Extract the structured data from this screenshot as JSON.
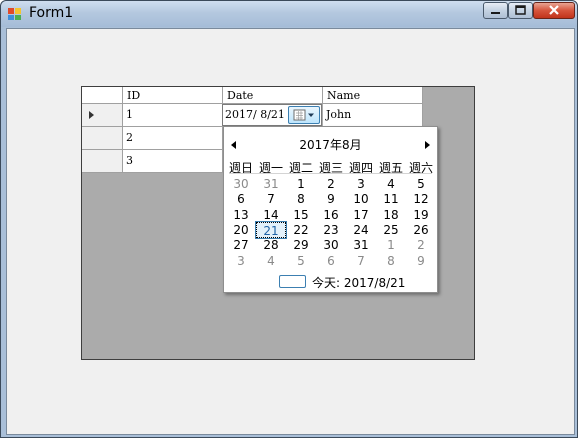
{
  "window": {
    "title": "Form1"
  },
  "grid": {
    "columns": [
      "ID",
      "Date",
      "Name"
    ],
    "rows": [
      {
        "id": "1",
        "date": "2017/ 8/21",
        "name": "John"
      },
      {
        "id": "2"
      },
      {
        "id": "3"
      }
    ]
  },
  "calendar": {
    "month_title": "2017年8月",
    "weekdays": [
      "週日",
      "週一",
      "週二",
      "週三",
      "週四",
      "週五",
      "週六"
    ],
    "weeks": [
      [
        "30",
        "31",
        "1",
        "2",
        "3",
        "4",
        "5"
      ],
      [
        "6",
        "7",
        "8",
        "9",
        "10",
        "11",
        "12"
      ],
      [
        "13",
        "14",
        "15",
        "16",
        "17",
        "18",
        "19"
      ],
      [
        "20",
        "21",
        "22",
        "23",
        "24",
        "25",
        "26"
      ],
      [
        "27",
        "28",
        "29",
        "30",
        "31",
        "1",
        "2"
      ],
      [
        "3",
        "4",
        "5",
        "6",
        "7",
        "8",
        "9"
      ]
    ],
    "selected": "21",
    "today_label": "今天: 2017/8/21"
  },
  "colors": {
    "grid_background": "#ababab",
    "selection_border": "#3c7fb1",
    "close_button": "#c1341c"
  }
}
